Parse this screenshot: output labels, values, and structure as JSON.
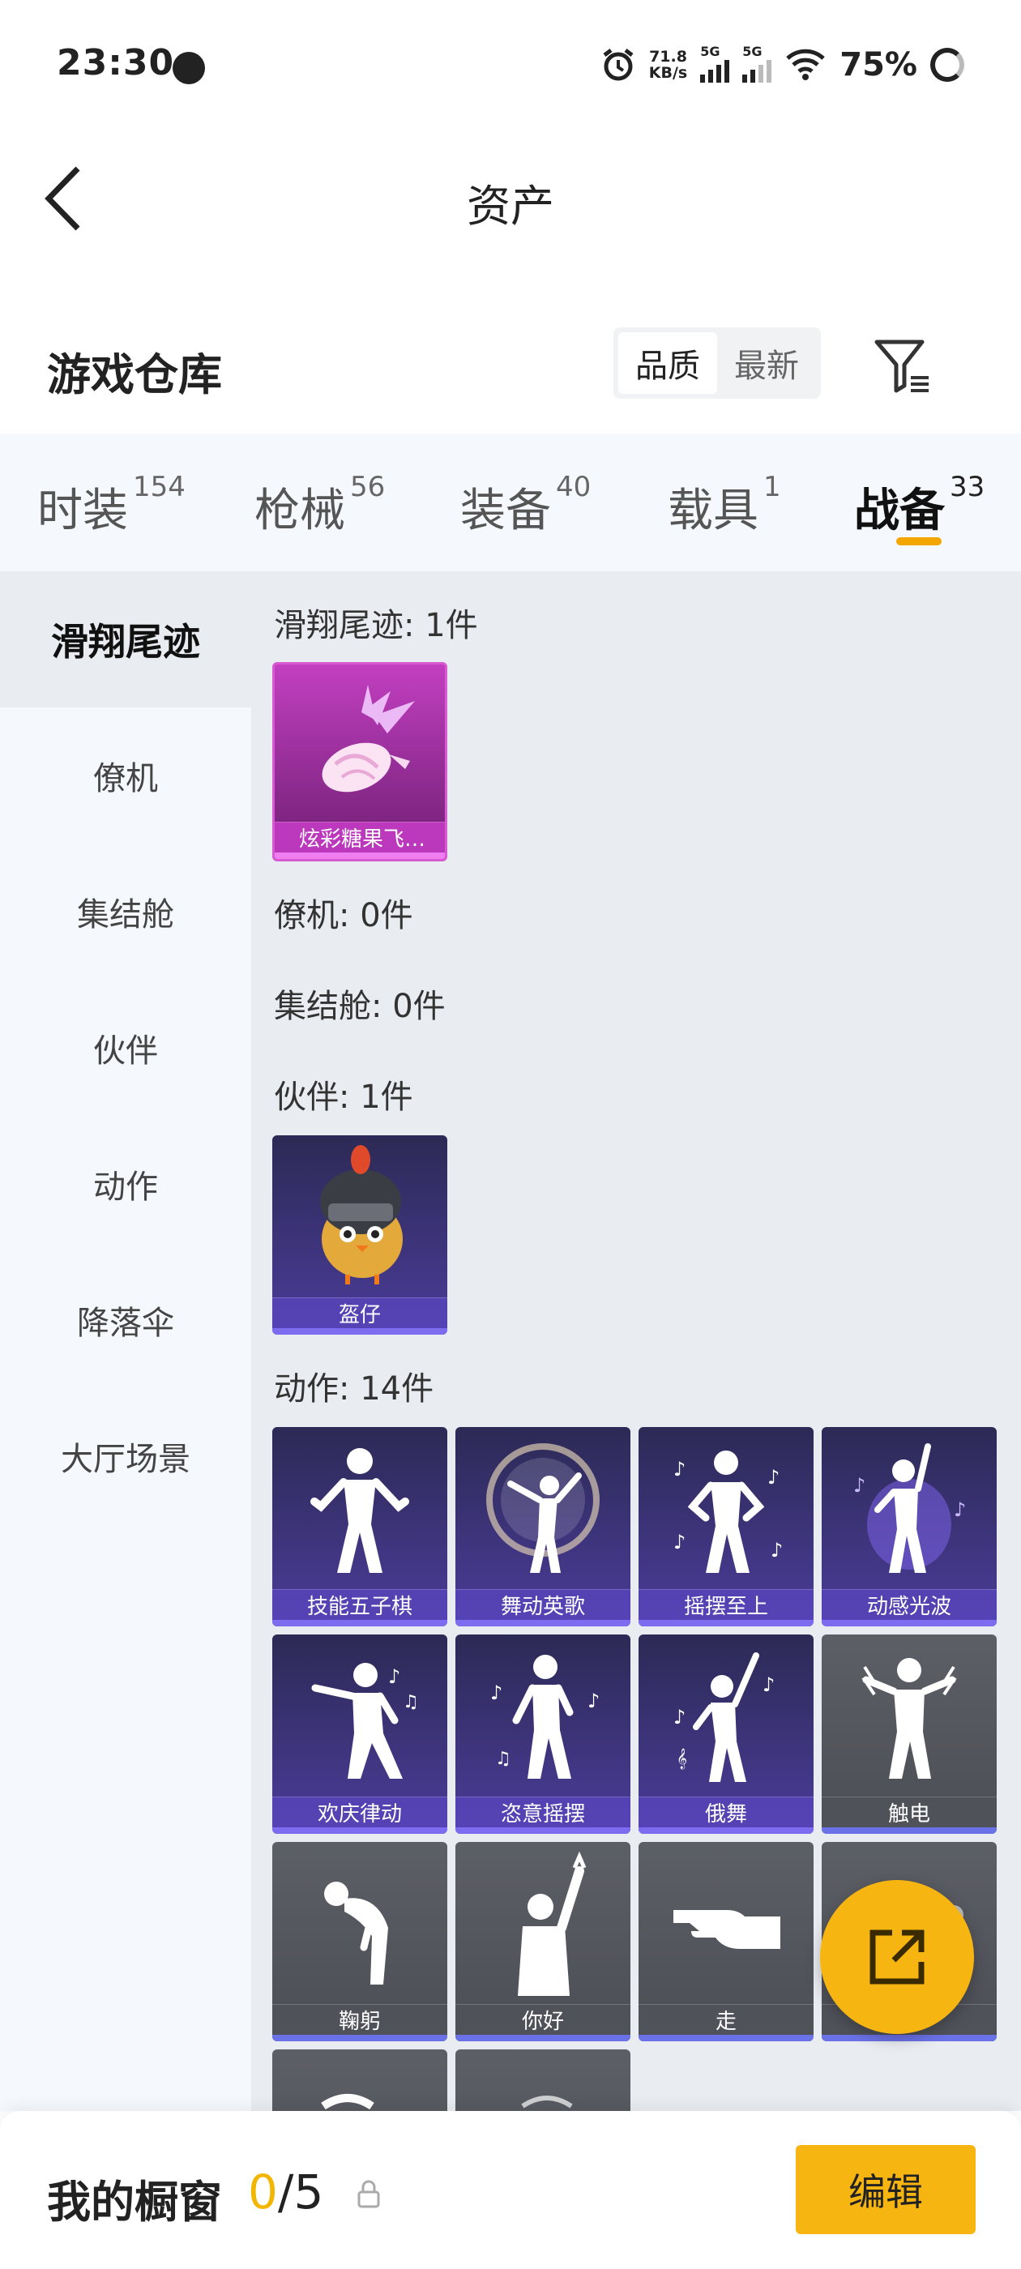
{
  "status_bar": {
    "time": "23:30",
    "net_speed_value": "71.8",
    "net_speed_unit": "KB/s",
    "sig1_label": "5G",
    "sig2_label": "5G",
    "battery": "75%"
  },
  "header": {
    "title": "资产"
  },
  "warehouse": {
    "title": "游戏仓库",
    "sort_options": [
      "品质",
      "最新"
    ],
    "sort_selected": "品质"
  },
  "tabs": [
    {
      "label": "时装",
      "count": "154"
    },
    {
      "label": "枪械",
      "count": "56"
    },
    {
      "label": "装备",
      "count": "40"
    },
    {
      "label": "载具",
      "count": "1"
    },
    {
      "label": "战备",
      "count": "33"
    }
  ],
  "active_tab": "战备",
  "sidebar": {
    "items": [
      "滑翔尾迹",
      "僚机",
      "集结舱",
      "伙伴",
      "动作",
      "降落伞",
      "大厅场景"
    ],
    "active": "滑翔尾迹"
  },
  "sections": [
    {
      "label": "滑翔尾迹: 1件",
      "items": [
        {
          "name": "炫彩糖果飞…",
          "quality": "pink",
          "icon": "candy-trail-icon"
        }
      ]
    },
    {
      "label": "僚机: 0件",
      "items": []
    },
    {
      "label": "集结舱: 0件",
      "items": []
    },
    {
      "label": "伙伴: 1件",
      "items": [
        {
          "name": "盔仔",
          "quality": "purple",
          "icon": "helmet-chick-icon"
        }
      ]
    },
    {
      "label": "动作: 14件",
      "items": [
        {
          "name": "技能五子棋",
          "quality": "purple",
          "icon": "dance-pose-icon"
        },
        {
          "name": "舞动英歌",
          "quality": "purple",
          "icon": "dance-orb-icon"
        },
        {
          "name": "摇摆至上",
          "quality": "purple",
          "icon": "dance-pose-icon"
        },
        {
          "name": "动感光波",
          "quality": "purple",
          "icon": "dance-glow-icon"
        },
        {
          "name": "欢庆律动",
          "quality": "purple",
          "icon": "dance-pose-icon"
        },
        {
          "name": "恣意摇摆",
          "quality": "purple",
          "icon": "dance-pose-icon"
        },
        {
          "name": "俄舞",
          "quality": "purple",
          "icon": "dance-pose-icon"
        },
        {
          "name": "触电",
          "quality": "gray",
          "icon": "shock-pose-icon"
        },
        {
          "name": "鞠躬",
          "quality": "gray",
          "icon": "bow-pose-icon"
        },
        {
          "name": "你好",
          "quality": "gray",
          "icon": "wave-pose-icon"
        },
        {
          "name": "走",
          "quality": "gray",
          "icon": "point-hand-icon"
        },
        {
          "name": "",
          "quality": "gray",
          "icon": "pose-icon"
        },
        {
          "name": "",
          "quality": "gray",
          "icon": "pose-icon"
        },
        {
          "name": "",
          "quality": "gray",
          "icon": "pose-icon"
        }
      ]
    }
  ],
  "showcase": {
    "label": "我的橱窗",
    "current": "0",
    "separator": "/",
    "max": "5"
  },
  "edit_button": "编辑",
  "colors": {
    "accent": "#f7b512",
    "pink": "#c23fc0",
    "purple": "#4b3c9a",
    "gray": "#55575e"
  }
}
